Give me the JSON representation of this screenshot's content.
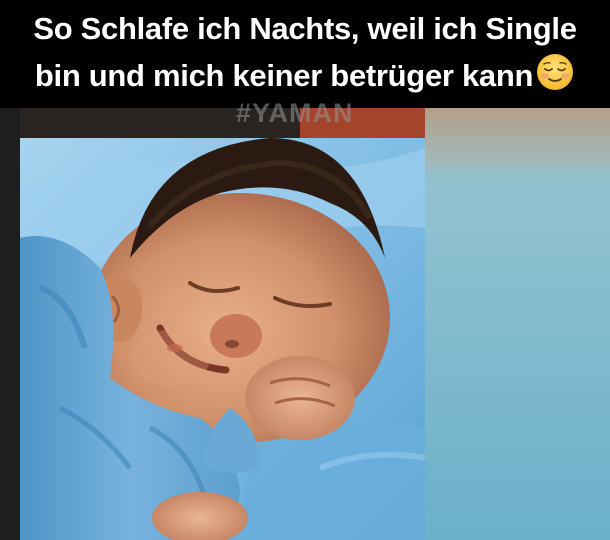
{
  "caption": {
    "line1": "So Schlafe ich Nachts, weil ich Single",
    "line2": "bin und mich keiner betrüger kann"
  },
  "emoji": "relieved-smile-emoji",
  "watermark": "#YAMAN",
  "photo": {
    "subject": "sleeping-smiling-baby-icon",
    "colors": {
      "blanket": "#7fbde2",
      "skin": "#d59a72",
      "hair": "#2a1a12",
      "background_right": "#8ec3d2"
    }
  }
}
